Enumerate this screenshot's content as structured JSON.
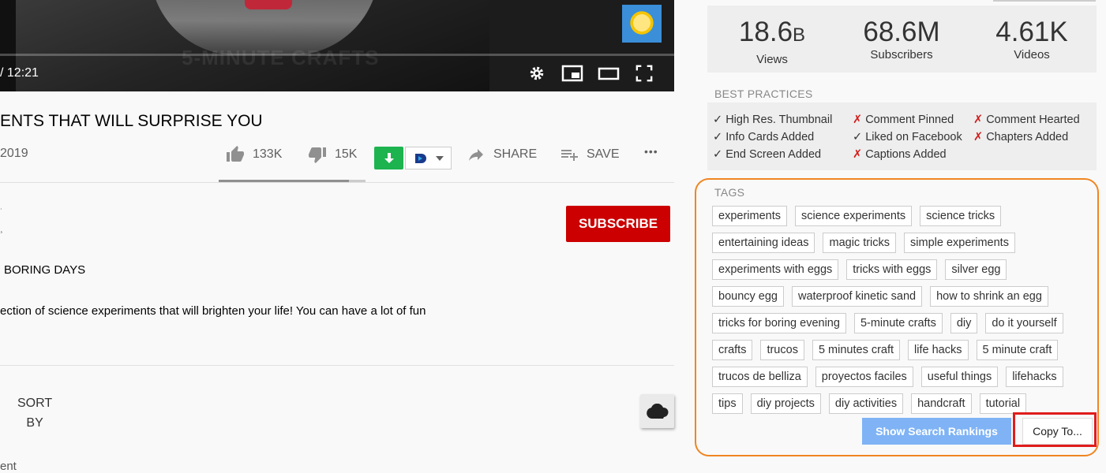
{
  "player": {
    "time": "/ 12:21",
    "watermark": "5-MINUTE CRAFTS",
    "controls": [
      "settings-icon",
      "miniplayer-icon",
      "theater-mode-icon",
      "fullscreen-icon"
    ]
  },
  "video": {
    "title": "ENTS THAT WILL SURPRISE YOU",
    "date": "2019",
    "likes": "133K",
    "dislikes": "15K",
    "share_label": "SHARE",
    "save_label": "SAVE",
    "more": "•••",
    "subscribe_label": "SUBSCRIBE",
    "description_line1": "BORING DAYS",
    "description_line2": "ection of science experiments that will brighten your life! You can have a lot of fun",
    "sort_label_1": "SORT",
    "sort_label_2": "BY",
    "stray_text": "ent",
    "edge_marks": [
      "˙",
      "¸"
    ]
  },
  "stats": {
    "views": "18.6",
    "views_suffix": "B",
    "views_label": "Views",
    "subscribers": "68.6M",
    "subscribers_label": "Subscribers",
    "videos": "4.61K",
    "videos_label": "Videos"
  },
  "best_practices": {
    "heading": "BEST PRACTICES",
    "items": [
      {
        "label": "High Res. Thumbnail",
        "status": "ok",
        "mark": "✓"
      },
      {
        "label": "Info Cards Added",
        "status": "ok",
        "mark": "✓"
      },
      {
        "label": "End Screen Added",
        "status": "ok",
        "mark": "✓"
      },
      {
        "label": "Comment Pinned",
        "status": "no",
        "mark": "✗"
      },
      {
        "label": "Liked on Facebook",
        "status": "ok",
        "mark": "✓"
      },
      {
        "label": "Captions Added",
        "status": "no",
        "mark": "✗"
      },
      {
        "label": "Comment Hearted",
        "status": "no",
        "mark": "✗"
      },
      {
        "label": "Chapters Added",
        "status": "no",
        "mark": "✗"
      }
    ]
  },
  "tags": {
    "heading": "TAGS",
    "rows": [
      [
        "experiments",
        "science experiments",
        "science tricks"
      ],
      [
        "entertaining ideas",
        "magic tricks",
        "simple experiments"
      ],
      [
        "experiments with eggs",
        "tricks with eggs",
        "silver egg"
      ],
      [
        "bouncy egg",
        "waterproof kinetic sand",
        "how to shrink an egg"
      ],
      [
        "tricks for boring evening",
        "5-minute crafts",
        "diy",
        "do it yourself"
      ],
      [
        "crafts",
        "trucos",
        "5 minutes craft",
        "life hacks",
        "5 minute craft"
      ],
      [
        "trucos de belliza",
        "proyectos faciles",
        "useful things",
        "lifehacks"
      ],
      [
        "tips",
        "diy projects",
        "diy activities",
        "handcraft",
        "tutorial"
      ]
    ],
    "show_rankings_label": "Show Search Rankings",
    "copy_label": "Copy To..."
  },
  "colors": {
    "subscribe": "#cc0000",
    "download": "#1db34f",
    "highlight_frame": "#f08522",
    "highlight_button": "#e01c1c",
    "rankings_button": "#7fb3f5"
  }
}
